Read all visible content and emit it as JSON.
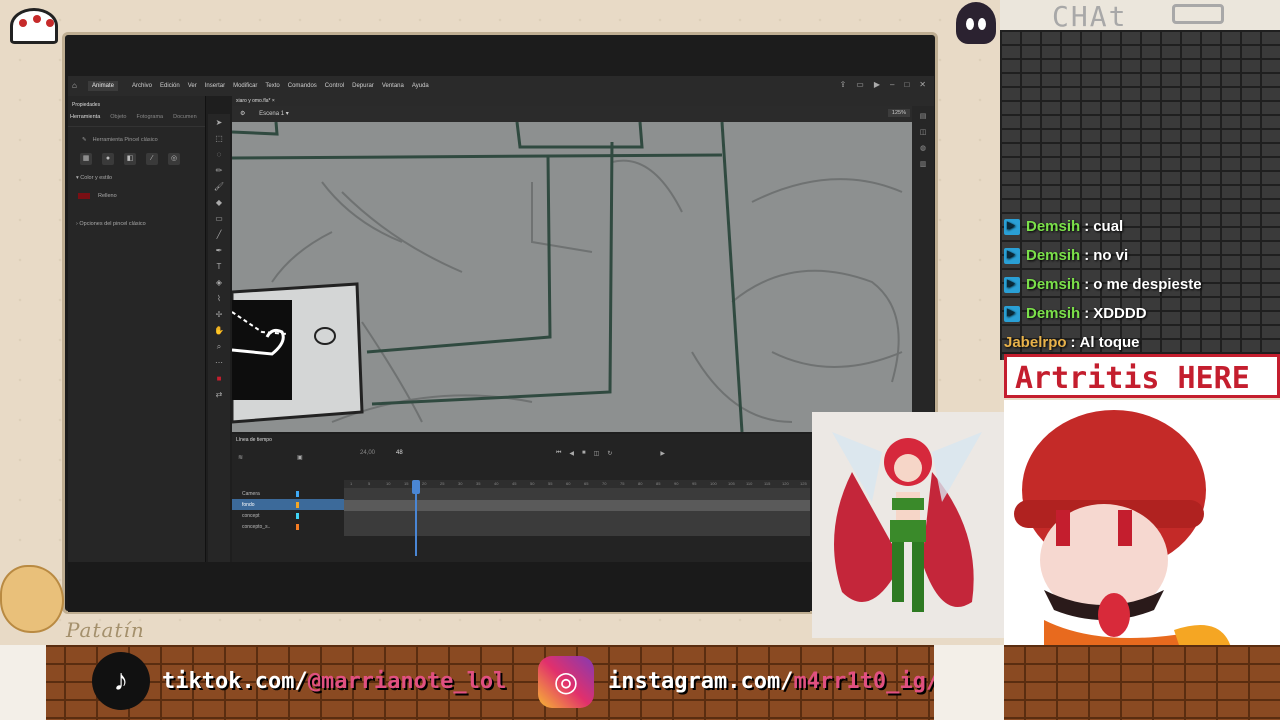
{
  "stream": {
    "signature": "Patatín",
    "chat_title": "CHAt",
    "banner": "Artritis HERE"
  },
  "animate": {
    "app_name": "Animate",
    "menu": [
      "Archivo",
      "Edición",
      "Ver",
      "Insertar",
      "Modificar",
      "Texto",
      "Comandos",
      "Control",
      "Depurar",
      "Ventana",
      "Ayuda"
    ],
    "panel_title": "Propiedades",
    "panel_tabs": [
      "Herramienta",
      "Objeto",
      "Fotograma",
      "Documen"
    ],
    "tool_name": "Herramienta Pincel clásico",
    "section_color": "Color y estilo",
    "fill_label": "Relleno",
    "section_options": "Opciones del pincel clásico",
    "doc_tab": "xiaro y omo.fla*",
    "scene": "Escena 1",
    "zoom": "125%",
    "timeline_title": "Línea de tiempo",
    "fps": "24,00",
    "frame": "48",
    "layers": [
      {
        "name": "Camera",
        "color": "#3fa9f5",
        "selected": false
      },
      {
        "name": "fondo",
        "color": "#f5a623",
        "selected": true
      },
      {
        "name": "concept",
        "color": "#3fd4f5",
        "selected": false
      },
      {
        "name": "concepto_s..",
        "color": "#f57c23",
        "selected": false
      }
    ],
    "ruler_ticks": [
      "1",
      "5",
      "10",
      "15",
      "20",
      "25",
      "30",
      "35",
      "40",
      "45",
      "50",
      "55",
      "60",
      "65",
      "70",
      "75",
      "80",
      "85",
      "90",
      "95",
      "100",
      "105",
      "110",
      "115",
      "120",
      "125"
    ]
  },
  "chat": [
    {
      "user": "Demsih",
      "message": "cual",
      "badge": true
    },
    {
      "user": "Demsih",
      "message": "no vi",
      "badge": true
    },
    {
      "user": "Demsih",
      "message": "o me despieste",
      "badge": true
    },
    {
      "user": "Demsih",
      "message": "XDDDD",
      "badge": true
    },
    {
      "user": "Jabelrpo",
      "message": "Al toque",
      "badge": false
    }
  ],
  "social": {
    "tiktok_prefix": "tiktok.com/",
    "tiktok_handle": "@marrianote_lol",
    "instagram_prefix": "instagram.com/",
    "instagram_handle": "m4rr1t0_ig/"
  },
  "colors": {
    "fill_swatch": "#7a0f14",
    "selected_layer": "#3c6a9a",
    "banner_red": "#c41e2e",
    "chat_user": "#7be04a"
  }
}
